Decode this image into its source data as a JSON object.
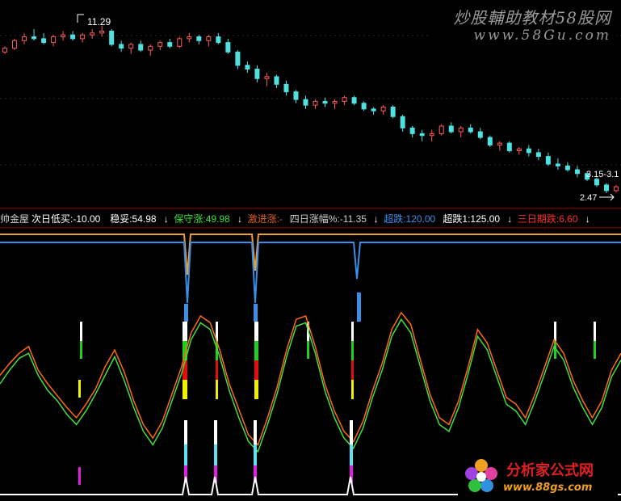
{
  "chart_data": [
    {
      "type": "candlestick",
      "title": "",
      "annotations": [
        {
          "text": "11.29"
        },
        {
          "text": "3.15-3.1"
        },
        {
          "text": "2.47"
        }
      ],
      "candles": [
        [
          9.9,
          10.2,
          9.8,
          10.1
        ],
        [
          10.1,
          10.6,
          10.0,
          10.5
        ],
        [
          10.5,
          10.9,
          10.3,
          10.7
        ],
        [
          10.7,
          11.1,
          10.5,
          10.6
        ],
        [
          10.6,
          10.9,
          10.3,
          10.4
        ],
        [
          10.4,
          10.8,
          10.2,
          10.7
        ],
        [
          10.7,
          11.0,
          10.5,
          10.8
        ],
        [
          10.8,
          11.0,
          10.5,
          10.6
        ],
        [
          10.6,
          10.9,
          10.4,
          10.8
        ],
        [
          10.8,
          11.1,
          10.6,
          10.9
        ],
        [
          10.9,
          11.29,
          10.7,
          11.0
        ],
        [
          11.0,
          11.1,
          10.2,
          10.3
        ],
        [
          10.3,
          10.5,
          9.9,
          10.1
        ],
        [
          10.1,
          10.4,
          9.8,
          10.3
        ],
        [
          10.3,
          10.5,
          9.9,
          10.0
        ],
        [
          10.0,
          10.3,
          9.7,
          10.2
        ],
        [
          10.2,
          10.5,
          10.0,
          10.4
        ],
        [
          10.4,
          10.6,
          10.1,
          10.2
        ],
        [
          10.2,
          10.7,
          10.1,
          10.6
        ],
        [
          10.6,
          10.9,
          10.4,
          10.7
        ],
        [
          10.7,
          10.8,
          10.3,
          10.5
        ],
        [
          10.5,
          10.8,
          10.2,
          10.7
        ],
        [
          10.7,
          10.9,
          10.3,
          10.4
        ],
        [
          10.4,
          10.6,
          9.8,
          9.9
        ],
        [
          9.9,
          10.0,
          9.0,
          9.2
        ],
        [
          9.2,
          9.4,
          8.8,
          9.0
        ],
        [
          9.0,
          9.2,
          8.3,
          8.5
        ],
        [
          8.5,
          8.8,
          8.1,
          8.6
        ],
        [
          8.6,
          8.7,
          8.0,
          8.2
        ],
        [
          8.2,
          8.4,
          7.6,
          7.8
        ],
        [
          7.8,
          7.9,
          7.2,
          7.4
        ],
        [
          7.4,
          7.6,
          6.9,
          7.1
        ],
        [
          7.1,
          7.4,
          6.9,
          7.3
        ],
        [
          7.3,
          7.5,
          7.0,
          7.2
        ],
        [
          7.2,
          7.4,
          6.9,
          7.3
        ],
        [
          7.3,
          7.6,
          7.1,
          7.5
        ],
        [
          7.5,
          7.6,
          7.1,
          7.2
        ],
        [
          7.2,
          7.3,
          6.8,
          6.9
        ],
        [
          6.9,
          7.0,
          6.6,
          6.8
        ],
        [
          6.8,
          7.1,
          6.6,
          7.0
        ],
        [
          7.0,
          7.1,
          6.4,
          6.5
        ],
        [
          6.5,
          6.6,
          5.7,
          5.9
        ],
        [
          5.9,
          6.0,
          5.4,
          5.6
        ],
        [
          5.6,
          5.8,
          5.2,
          5.5
        ],
        [
          5.5,
          5.8,
          5.2,
          5.6
        ],
        [
          5.6,
          6.1,
          5.5,
          6.0
        ],
        [
          6.0,
          6.2,
          5.6,
          5.7
        ],
        [
          5.7,
          6.0,
          5.4,
          5.9
        ],
        [
          5.9,
          6.1,
          5.6,
          5.7
        ],
        [
          5.7,
          5.9,
          5.3,
          5.4
        ],
        [
          5.4,
          5.5,
          4.9,
          5.0
        ],
        [
          5.0,
          5.2,
          4.7,
          5.1
        ],
        [
          5.1,
          5.2,
          4.6,
          4.7
        ],
        [
          4.7,
          4.9,
          4.5,
          4.8
        ],
        [
          4.8,
          5.0,
          4.4,
          4.6
        ],
        [
          4.6,
          4.8,
          4.2,
          4.4
        ],
        [
          4.4,
          4.6,
          3.9,
          4.0
        ],
        [
          4.0,
          4.3,
          3.7,
          3.9
        ],
        [
          3.9,
          4.1,
          3.6,
          3.7
        ],
        [
          3.7,
          3.9,
          3.3,
          3.5
        ],
        [
          3.5,
          3.6,
          3.1,
          3.2
        ],
        [
          3.2,
          3.3,
          2.8,
          2.9
        ],
        [
          2.9,
          3.0,
          2.47,
          2.6
        ],
        [
          2.6,
          2.9,
          2.5,
          2.8
        ]
      ],
      "price_range": [
        2.0,
        12.0
      ]
    },
    {
      "type": "line",
      "header": [
        {
          "text": "帅金屋",
          "color": "#cfcfcf"
        },
        {
          "text": "次日低买:-10.00",
          "color": "#ffffff"
        },
        {
          "text": "稳妥:54.98",
          "color": "#ffffff"
        },
        {
          "text": "↓",
          "color": "#ffffff"
        },
        {
          "text": "保守涨:49.98",
          "color": "#38e038"
        },
        {
          "text": "↓",
          "color": "#ffffff"
        },
        {
          "text": "激进涨:-",
          "color": "#e06020"
        },
        {
          "text": "四日涨幅%:-11.35",
          "color": "#cfcfcf"
        },
        {
          "text": "↓",
          "color": "#ffffff"
        },
        {
          "text": "超跌:120.00",
          "color": "#3a8fe8"
        },
        {
          "text": "超跌1:125.00",
          "color": "#ffffff"
        },
        {
          "text": "↓",
          "color": "#ffffff"
        },
        {
          "text": "三日期跌:6.60",
          "color": "#ff3030"
        },
        {
          "text": "↓",
          "color": "#ffffff"
        }
      ],
      "series": [
        {
          "color": "#ff6a10",
          "values": [
            55,
            62,
            68,
            72,
            58,
            50,
            43,
            36,
            30,
            38,
            47,
            60,
            70,
            57,
            40,
            26,
            18,
            28,
            44,
            60,
            80,
            90,
            86,
            70,
            50,
            35,
            20,
            14,
            30,
            48,
            70,
            88,
            90,
            72,
            50,
            34,
            22,
            16,
            28,
            46,
            62,
            82,
            92,
            85,
            64,
            44,
            30,
            26,
            40,
            60,
            82,
            74,
            58,
            42,
            38,
            30,
            44,
            60,
            76,
            68,
            52,
            40,
            30,
            40,
            58,
            68
          ]
        },
        {
          "color": "#40e040",
          "values": [
            50,
            58,
            65,
            68,
            55,
            46,
            40,
            32,
            26,
            34,
            44,
            55,
            66,
            52,
            36,
            22,
            14,
            24,
            40,
            56,
            76,
            86,
            82,
            66,
            46,
            30,
            16,
            10,
            26,
            44,
            66,
            84,
            86,
            68,
            46,
            30,
            18,
            12,
            24,
            42,
            58,
            78,
            88,
            80,
            60,
            40,
            26,
            22,
            36,
            56,
            78,
            70,
            54,
            38,
            34,
            26,
            40,
            56,
            72,
            64,
            48,
            36,
            26,
            36,
            54,
            64
          ]
        }
      ]
    }
  ],
  "watermarks": [
    {
      "title": "炒股輔助教材58股网",
      "url": "www.58Gu.com"
    },
    {
      "title": "分析家公式网",
      "url": "www.88gs.com"
    }
  ]
}
